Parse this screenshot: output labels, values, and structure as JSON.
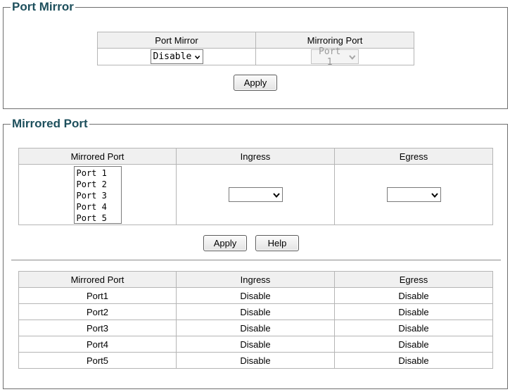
{
  "port_mirror": {
    "title": "Port Mirror",
    "headers": [
      "Port Mirror",
      "Mirroring Port"
    ],
    "mode_value": "Disable",
    "mirroring_port_value": "Port 1",
    "apply_label": "Apply"
  },
  "mirrored_port": {
    "title": "Mirrored Port",
    "headers": [
      "Mirrored Port",
      "Ingress",
      "Egress"
    ],
    "port_options": [
      "Port 1",
      "Port 2",
      "Port 3",
      "Port 4",
      "Port 5"
    ],
    "ingress_value": "",
    "egress_value": "",
    "apply_label": "Apply",
    "help_label": "Help",
    "status_headers": [
      "Mirrored Port",
      "Ingress",
      "Egress"
    ],
    "status_rows": [
      {
        "port": "Port1",
        "ingress": "Disable",
        "egress": "Disable"
      },
      {
        "port": "Port2",
        "ingress": "Disable",
        "egress": "Disable"
      },
      {
        "port": "Port3",
        "ingress": "Disable",
        "egress": "Disable"
      },
      {
        "port": "Port4",
        "ingress": "Disable",
        "egress": "Disable"
      },
      {
        "port": "Port5",
        "ingress": "Disable",
        "egress": "Disable"
      }
    ]
  },
  "icons": {
    "dropdown": "chevron-down-icon"
  }
}
